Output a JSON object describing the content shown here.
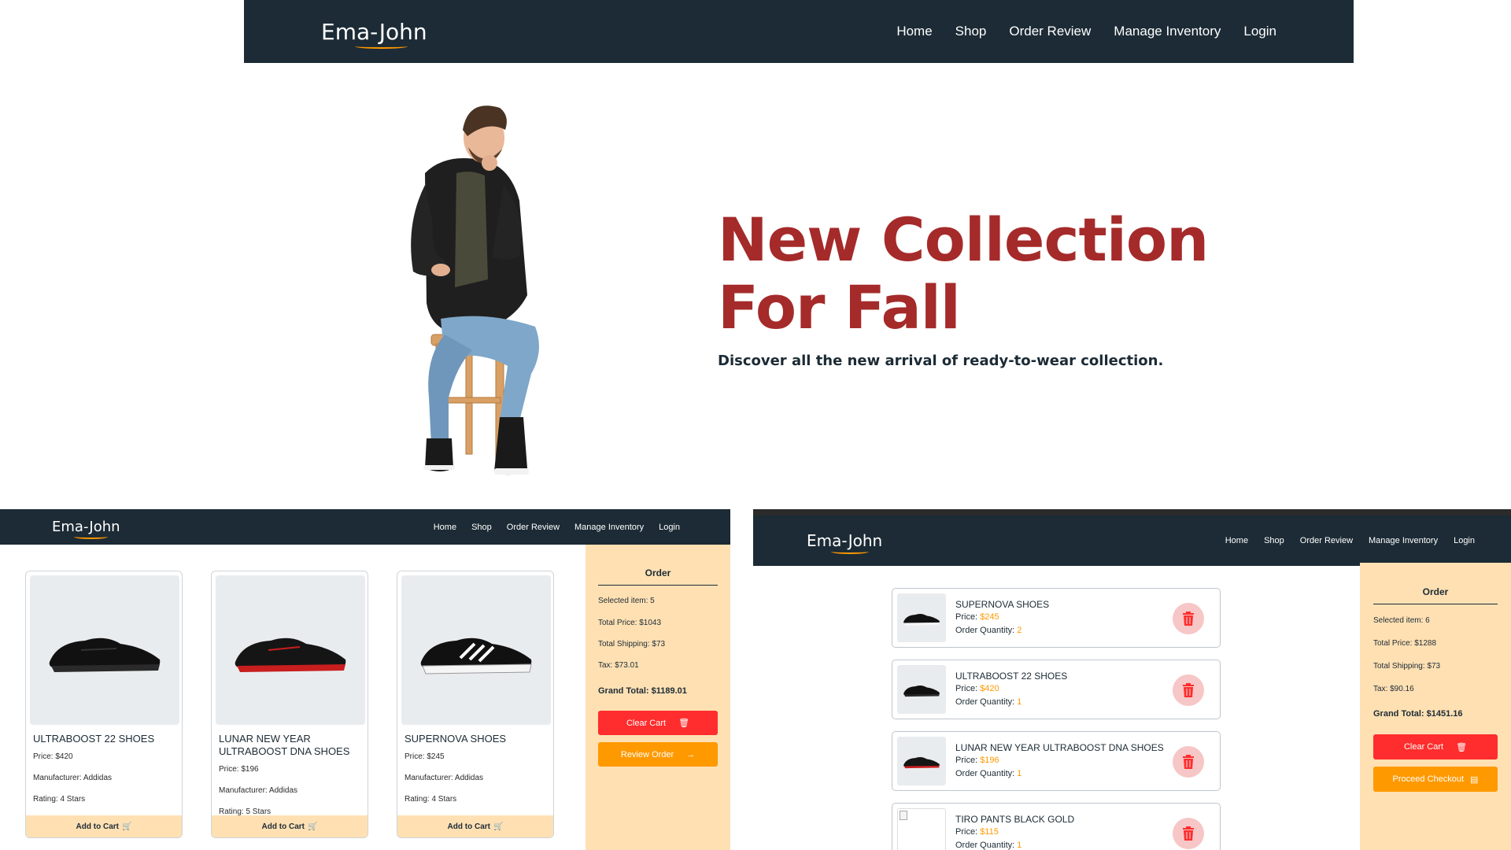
{
  "brand": "Ema-John",
  "nav": {
    "home": "Home",
    "shop": "Shop",
    "order_review": "Order Review",
    "manage_inventory": "Manage Inventory",
    "login": "Login"
  },
  "hero": {
    "title_line1": "New Collection",
    "title_line2": "For Fall",
    "subtitle": "Discover all the new arrival of ready-to-wear collection."
  },
  "shop": {
    "products": [
      {
        "name": "ULTRABOOST 22 SHOES",
        "price": "Price: $420",
        "manufacturer": "Manufacturer: Addidas",
        "rating": "Rating: 4 Stars",
        "button": "Add to Cart"
      },
      {
        "name": "LUNAR NEW YEAR ULTRABOOST DNA SHOES",
        "price": "Price: $196",
        "manufacturer": "Manufacturer: Addidas",
        "rating": "Rating: 5 Stars",
        "button": "Add to Cart"
      },
      {
        "name": "SUPERNOVA SHOES",
        "price": "Price: $245",
        "manufacturer": "Manufacturer: Addidas",
        "rating": "Rating: 4 Stars",
        "button": "Add to Cart"
      }
    ],
    "order": {
      "title": "Order",
      "selected": "Selected item: 5",
      "total_price": "Total Price: $1043",
      "shipping": "Total Shipping: $73",
      "tax": "Tax: $73.01",
      "grand_total": "Grand Total: $1189.01",
      "clear_label": "Clear Cart",
      "review_label": "Review Order"
    }
  },
  "review": {
    "items": [
      {
        "name": "SUPERNOVA SHOES",
        "price_label": "Price: ",
        "price": "$245",
        "qty_label": "Order Quantity: ",
        "qty": "2"
      },
      {
        "name": "ULTRABOOST 22 SHOES",
        "price_label": "Price: ",
        "price": "$420",
        "qty_label": "Order Quantity: ",
        "qty": "1"
      },
      {
        "name": "LUNAR NEW YEAR ULTRABOOST DNA SHOES",
        "price_label": "Price: ",
        "price": "$196",
        "qty_label": "Order Quantity: ",
        "qty": "1"
      },
      {
        "name": "TIRO PANTS BLACK GOLD",
        "price_label": "Price: ",
        "price": "$115",
        "qty_label": "Order Quantity: ",
        "qty": "1"
      }
    ],
    "order": {
      "title": "Order",
      "selected": "Selected item: 6",
      "total_price": "Total Price: $1288",
      "shipping": "Total Shipping: $73",
      "tax": "Tax: $90.16",
      "grand_total": "Grand Total: $1451.16",
      "clear_label": "Clear Cart",
      "checkout_label": "Proceed Checkout"
    }
  },
  "colors": {
    "navy": "#1c2b35",
    "hero_red": "#a52a2a",
    "accent_orange": "#ff9900",
    "cart_bg": "#ffe0b3",
    "danger": "#ff2d2d"
  }
}
